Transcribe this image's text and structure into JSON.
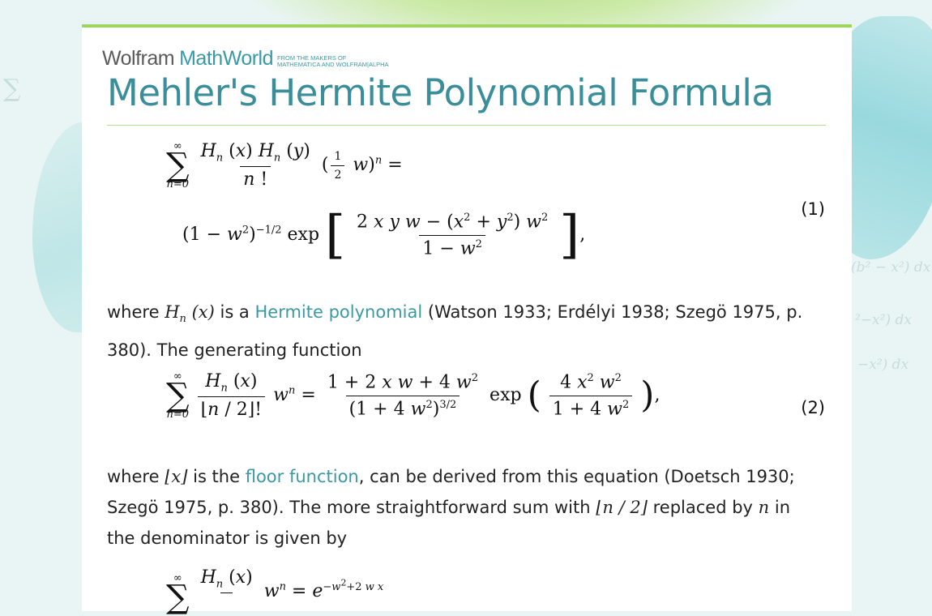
{
  "logo": {
    "wolfram": "Wolfram",
    "mathworld": "MathWorld",
    "tagline": "FROM THE MAKERS OF MATHEMATICA AND WOLFRAM|ALPHA"
  },
  "page": {
    "title": "Mehler's Hermite Polynomial Formula"
  },
  "equations": {
    "eq1_number": "(1)",
    "eq2_number": "(2)"
  },
  "paragraphs": {
    "p1_where": "where",
    "p1_is_a": "is a",
    "p1_link": "Hermite polynomial",
    "p1_tail": "(Watson 1933; Erdélyi 1938; Szegö 1975, p. 380). The generating function",
    "p2_where": "where",
    "p2_is_the": "is the",
    "p2_link": "floor function",
    "p2_mid": ", can be derived from this equation (Doetsch 1930; Szegö 1975, p. 380). The more straightforward sum with",
    "p2_replaced": "replaced by",
    "p2_tail": "in the denominator is given by"
  },
  "colors": {
    "accent": "#3a9aa4",
    "title": "#3a8e9a",
    "rule": "#9cd65d"
  }
}
